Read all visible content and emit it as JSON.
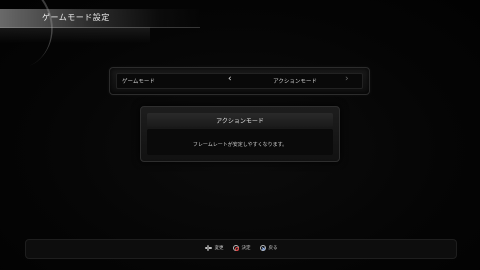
{
  "header": {
    "title": "ゲームモード設定"
  },
  "selector": {
    "label": "ゲームモード",
    "value": "アクションモード",
    "arrow_left": "‹",
    "arrow_right": "›"
  },
  "description": {
    "title": "アクションモード",
    "text": "フレームレートが安定しやすくなります。"
  },
  "guide": {
    "change_label": "変更",
    "confirm_label": "決定",
    "back_label": "戻る",
    "change_icon": "dpad-icon",
    "confirm_icon": "circle-button-icon",
    "back_icon": "cross-button-icon"
  },
  "colors": {
    "background": "#050505",
    "panel": "#1d1d1d",
    "text": "#d8d8d8",
    "circle_button": "#dd4444",
    "cross_button": "#8fb0e8"
  }
}
